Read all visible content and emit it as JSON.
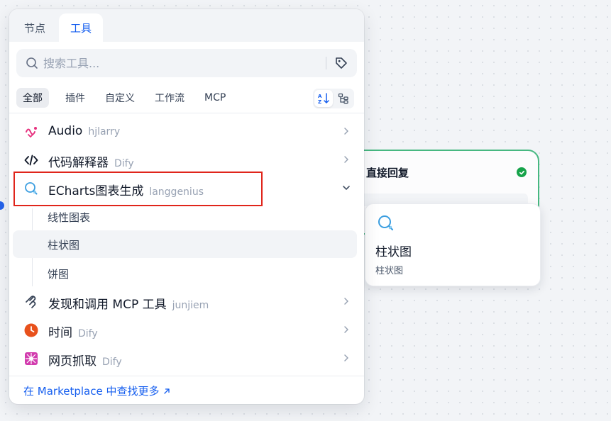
{
  "canvas": {
    "node_title": "直接回复"
  },
  "tooltip": {
    "title": "柱状图",
    "description": "柱状图"
  },
  "panel": {
    "tabs": [
      {
        "label": "节点"
      },
      {
        "label": "工具"
      }
    ],
    "search": {
      "placeholder": "搜索工具..."
    },
    "filters": [
      {
        "label": "全部"
      },
      {
        "label": "插件"
      },
      {
        "label": "自定义"
      },
      {
        "label": "工作流"
      },
      {
        "label": "MCP"
      }
    ],
    "tools": [
      {
        "name": "Audio",
        "author": "hjlarry",
        "icon": "audio-icon"
      },
      {
        "name": "代码解释器",
        "author": "Dify",
        "icon": "code-icon"
      },
      {
        "name": "ECharts图表生成",
        "author": "langgenius",
        "icon": "echarts-icon",
        "expanded": true
      },
      {
        "name": "发现和调用 MCP 工具",
        "author": "junjiem",
        "icon": "mcp-icon"
      },
      {
        "name": "时间",
        "author": "Dify",
        "icon": "clock-icon"
      },
      {
        "name": "网页抓取",
        "author": "Dify",
        "icon": "webscraper-icon"
      }
    ],
    "sub_tools": [
      {
        "label": "线性图表"
      },
      {
        "label": "柱状图"
      },
      {
        "label": "饼图"
      }
    ],
    "footer_link": "在 Marketplace 中查找更多"
  },
  "colors": {
    "accent": "#155eef",
    "highlight_border": "#e0251b",
    "node_border": "#47b881"
  }
}
